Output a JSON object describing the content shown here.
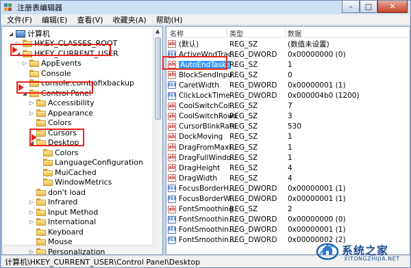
{
  "window": {
    "title": "注册表编辑器",
    "controls": {
      "minimize": "–",
      "maximize": "□",
      "close": "✕"
    }
  },
  "menu": [
    "文件(F)",
    "编辑(E)",
    "查看(V)",
    "收藏夹(A)",
    "帮助(H)"
  ],
  "tree": {
    "items": [
      {
        "label": "计算机",
        "icon": "computer-icon",
        "expander": "expanded"
      },
      {
        "label": "HKEY_CLASSES_ROOT",
        "icon": "folder-icon",
        "expander": "collapsed"
      },
      {
        "label": "HKEY_CURRENT_USER",
        "icon": "folder-icon",
        "expander": "expanded"
      },
      {
        "label": "AppEvents",
        "icon": "folder-icon",
        "expander": "collapsed"
      },
      {
        "label": "Console",
        "icon": "folder-icon",
        "expander": "none"
      },
      {
        "label": "console.combofixbackup",
        "icon": "folder-icon",
        "expander": "none"
      },
      {
        "label": "Control Panel",
        "icon": "folder-icon",
        "expander": "expanded"
      },
      {
        "label": "Accessibility",
        "icon": "folder-icon",
        "expander": "collapsed"
      },
      {
        "label": "Appearance",
        "icon": "folder-icon",
        "expander": "collapsed"
      },
      {
        "label": "Colors",
        "icon": "folder-icon",
        "expander": "none"
      },
      {
        "label": "Cursors",
        "icon": "folder-icon",
        "expander": "none"
      },
      {
        "label": "Desktop",
        "icon": "folder-icon",
        "expander": "expanded"
      },
      {
        "label": "Colors",
        "icon": "folder-icon",
        "expander": "none"
      },
      {
        "label": "LanguageConfiguration",
        "icon": "folder-icon",
        "expander": "none"
      },
      {
        "label": "MuiCached",
        "icon": "folder-icon",
        "expander": "none"
      },
      {
        "label": "WindowMetrics",
        "icon": "folder-icon",
        "expander": "none"
      },
      {
        "label": "don't load",
        "icon": "folder-icon",
        "expander": "none"
      },
      {
        "label": "Infrared",
        "icon": "folder-icon",
        "expander": "collapsed"
      },
      {
        "label": "Input Method",
        "icon": "folder-icon",
        "expander": "collapsed"
      },
      {
        "label": "International",
        "icon": "folder-icon",
        "expander": "collapsed"
      },
      {
        "label": "Keyboard",
        "icon": "folder-icon",
        "expander": "none"
      },
      {
        "label": "Mouse",
        "icon": "folder-icon",
        "expander": "none"
      },
      {
        "label": "Personalization",
        "icon": "folder-icon",
        "expander": "collapsed"
      }
    ]
  },
  "list": {
    "headers": {
      "name": "名称",
      "type": "类型",
      "data": "数据"
    },
    "rows": [
      {
        "name": "(默认)",
        "type": "REG_SZ",
        "data": "(数值未设置)",
        "icon": "ab"
      },
      {
        "name": "ActiveWndTrac...",
        "type": "REG_DWORD",
        "data": "0x00000000 (0)",
        "icon": "bin"
      },
      {
        "name": "AutoEndTasks",
        "type": "REG_SZ",
        "data": "1",
        "icon": "ab",
        "selected": true
      },
      {
        "name": "BlockSendInpu...",
        "type": "REG_SZ",
        "data": "0",
        "icon": "ab"
      },
      {
        "name": "CaretWidth",
        "type": "REG_DWORD",
        "data": "0x00000001 (1)",
        "icon": "bin"
      },
      {
        "name": "ClickLockTime",
        "type": "REG_DWORD",
        "data": "0x000004b0 (1200)",
        "icon": "bin"
      },
      {
        "name": "CoolSwitchCol...",
        "type": "REG_SZ",
        "data": "7",
        "icon": "ab"
      },
      {
        "name": "CoolSwitchRows",
        "type": "REG_SZ",
        "data": "3",
        "icon": "ab"
      },
      {
        "name": "CursorBlinkRate",
        "type": "REG_SZ",
        "data": "530",
        "icon": "ab"
      },
      {
        "name": "DockMoving",
        "type": "REG_SZ",
        "data": "1",
        "icon": "ab"
      },
      {
        "name": "DragFromMaxi...",
        "type": "REG_SZ",
        "data": "1",
        "icon": "ab"
      },
      {
        "name": "DragFullWindo...",
        "type": "REG_SZ",
        "data": "1",
        "icon": "ab"
      },
      {
        "name": "DragHeight",
        "type": "REG_SZ",
        "data": "4",
        "icon": "ab"
      },
      {
        "name": "DragWidth",
        "type": "REG_SZ",
        "data": "4",
        "icon": "ab"
      },
      {
        "name": "FocusBorderH...",
        "type": "REG_DWORD",
        "data": "0x00000001 (1)",
        "icon": "bin"
      },
      {
        "name": "FocusBorderW...",
        "type": "REG_DWORD",
        "data": "0x00000001 (1)",
        "icon": "bin"
      },
      {
        "name": "FontSmoothing",
        "type": "REG_SZ",
        "data": "2",
        "icon": "ab"
      },
      {
        "name": "FontSmoothin...",
        "type": "REG_DWORD",
        "data": "0x00000000 (0)",
        "icon": "bin"
      },
      {
        "name": "FontSmoothin...",
        "type": "REG_DWORD",
        "data": "0x00000001 (1)",
        "icon": "bin"
      },
      {
        "name": "FontSmoothin...",
        "type": "REG_DWORD",
        "data": "0x00000002 (2)",
        "icon": "bin"
      }
    ]
  },
  "status": "计算机\\HKEY_CURRENT_USER\\Control Panel\\Desktop",
  "watermark": {
    "title": "系统之家",
    "subtitle": "XITONGZHIJIA.NET"
  },
  "colors": {
    "highlight": "#e8231d",
    "selection": "#3399ff"
  }
}
